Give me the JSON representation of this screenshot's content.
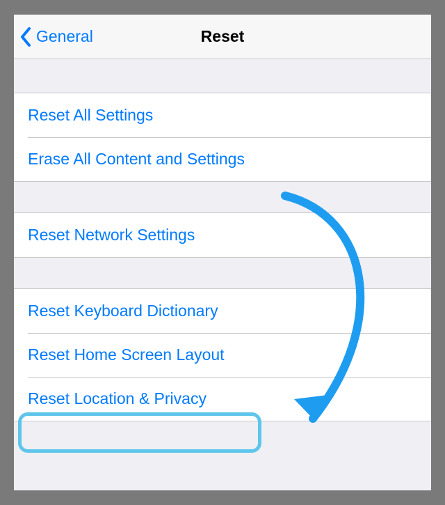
{
  "colors": {
    "accent": "#007AFF",
    "annotation": "#1E9DF0",
    "highlight": "#5EC5EB"
  },
  "nav": {
    "back_label": "General",
    "title": "Reset"
  },
  "groups": [
    {
      "id": "g1",
      "rows": [
        {
          "id": "reset-all-settings",
          "label": "Reset All Settings"
        },
        {
          "id": "erase-all-content",
          "label": "Erase All Content and Settings"
        }
      ]
    },
    {
      "id": "g2",
      "rows": [
        {
          "id": "reset-network-settings",
          "label": "Reset Network Settings"
        }
      ]
    },
    {
      "id": "g3",
      "rows": [
        {
          "id": "reset-keyboard-dictionary",
          "label": "Reset Keyboard Dictionary"
        },
        {
          "id": "reset-home-screen-layout",
          "label": "Reset Home Screen Layout"
        },
        {
          "id": "reset-location-privacy",
          "label": "Reset Location & Privacy"
        }
      ]
    }
  ]
}
